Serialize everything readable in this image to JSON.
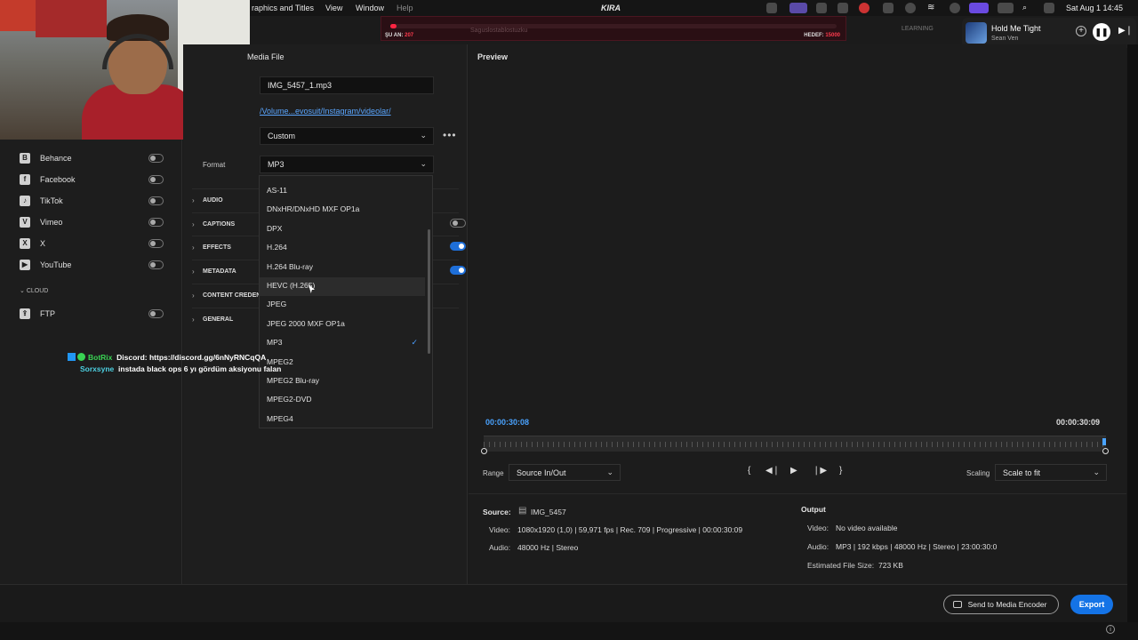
{
  "menubar": {
    "app_menu": "raphics and Titles",
    "menus": [
      "View",
      "Window",
      "Help"
    ],
    "center_logo": "KIRA",
    "clock": "Sat Aug 1  14:45"
  },
  "stream_goal": {
    "current_label": "ŞU AN:",
    "current_value": "207",
    "goal_label": "HEDEF:",
    "goal_value": "15000",
    "progress": 0.014,
    "ticker": "Saguslostablostuzku"
  },
  "learning_label": "LEARNING",
  "now_playing": {
    "title": "Hold Me Tight",
    "artist": "Sean Ven",
    "add_glyph": "+",
    "pause_glyph": "❚❚",
    "next_glyph": "▶❘"
  },
  "destinations": [
    {
      "name": "Behance",
      "icon": "behance-icon",
      "glyph": "B"
    },
    {
      "name": "Facebook",
      "icon": "facebook-icon",
      "glyph": "f"
    },
    {
      "name": "TikTok",
      "icon": "tiktok-icon",
      "glyph": "♪"
    },
    {
      "name": "Vimeo",
      "icon": "vimeo-icon",
      "glyph": "V"
    },
    {
      "name": "X",
      "icon": "x-icon",
      "glyph": "X"
    },
    {
      "name": "YouTube",
      "icon": "youtube-icon",
      "glyph": "▶"
    }
  ],
  "cloud": {
    "header": "CLOUD",
    "items": [
      {
        "name": "FTP",
        "icon": "ftp-icon",
        "glyph": "⇪"
      }
    ]
  },
  "chat": [
    {
      "user": "BotRix",
      "message": "Discord: https://discord.gg/6nNyRNCqQA"
    },
    {
      "user": "Sorxsyne",
      "message": "instada black ops 6 yı gördüm aksiyonu falan"
    }
  ],
  "settings": {
    "media_file_header": "Media File",
    "filename": "IMG_5457_1.mp3",
    "location": "/Volume...evosuit/Instagram/videolar/",
    "preset": "Custom",
    "more_glyph": "•••",
    "format_label": "Format",
    "format_value": "MP3",
    "sections": [
      {
        "label": "AUDIO",
        "toggle": null
      },
      {
        "label": "CAPTIONS",
        "toggle": "off"
      },
      {
        "label": "EFFECTS",
        "toggle": "on"
      },
      {
        "label": "METADATA",
        "toggle": "on"
      },
      {
        "label": "CONTENT CREDENTIALS",
        "toggle": null
      },
      {
        "label": "GENERAL",
        "toggle": null
      }
    ]
  },
  "format_options": [
    "AS-11",
    "DNxHR/DNxHD MXF OP1a",
    "DPX",
    "H.264",
    "H.264 Blu-ray",
    "HEVC (H.265)",
    "JPEG",
    "JPEG 2000 MXF OP1a",
    "MP3",
    "MPEG2",
    "MPEG2 Blu-ray",
    "MPEG2-DVD",
    "MPEG4"
  ],
  "format_selected": "MP3",
  "format_hovered": "HEVC (H.265)",
  "preview": {
    "header": "Preview",
    "tc_in": "00:00:30:08",
    "tc_out": "00:00:30:09",
    "range_label": "Range",
    "range_value": "Source In/Out",
    "scaling_label": "Scaling",
    "scaling_value": "Scale to fit",
    "transport": [
      "{",
      "◀❘",
      "▶",
      "❘▶",
      "}"
    ]
  },
  "source": {
    "label": "Source:",
    "name": "IMG_5457",
    "video_label": "Video:",
    "video_value": "1080x1920 (1,0)  |  59,971 fps  |  Rec. 709  |  Progressive  |  00:00:30:09",
    "audio_label": "Audio:",
    "audio_value": "48000 Hz  |  Stereo"
  },
  "output": {
    "label": "Output",
    "video_label": "Video:",
    "video_value": "No video available",
    "audio_label": "Audio:",
    "audio_value": "MP3  |  192 kbps  |  48000 Hz  |  Stereo  |  23:00:30:0",
    "size_label": "Estimated File Size:",
    "size_value": "723 KB"
  },
  "buttons": {
    "send": "Send to Media Encoder",
    "export": "Export"
  },
  "colors": {
    "accent": "#1473e6",
    "link": "#5aa6ff",
    "goal_red": "#ff2442"
  }
}
